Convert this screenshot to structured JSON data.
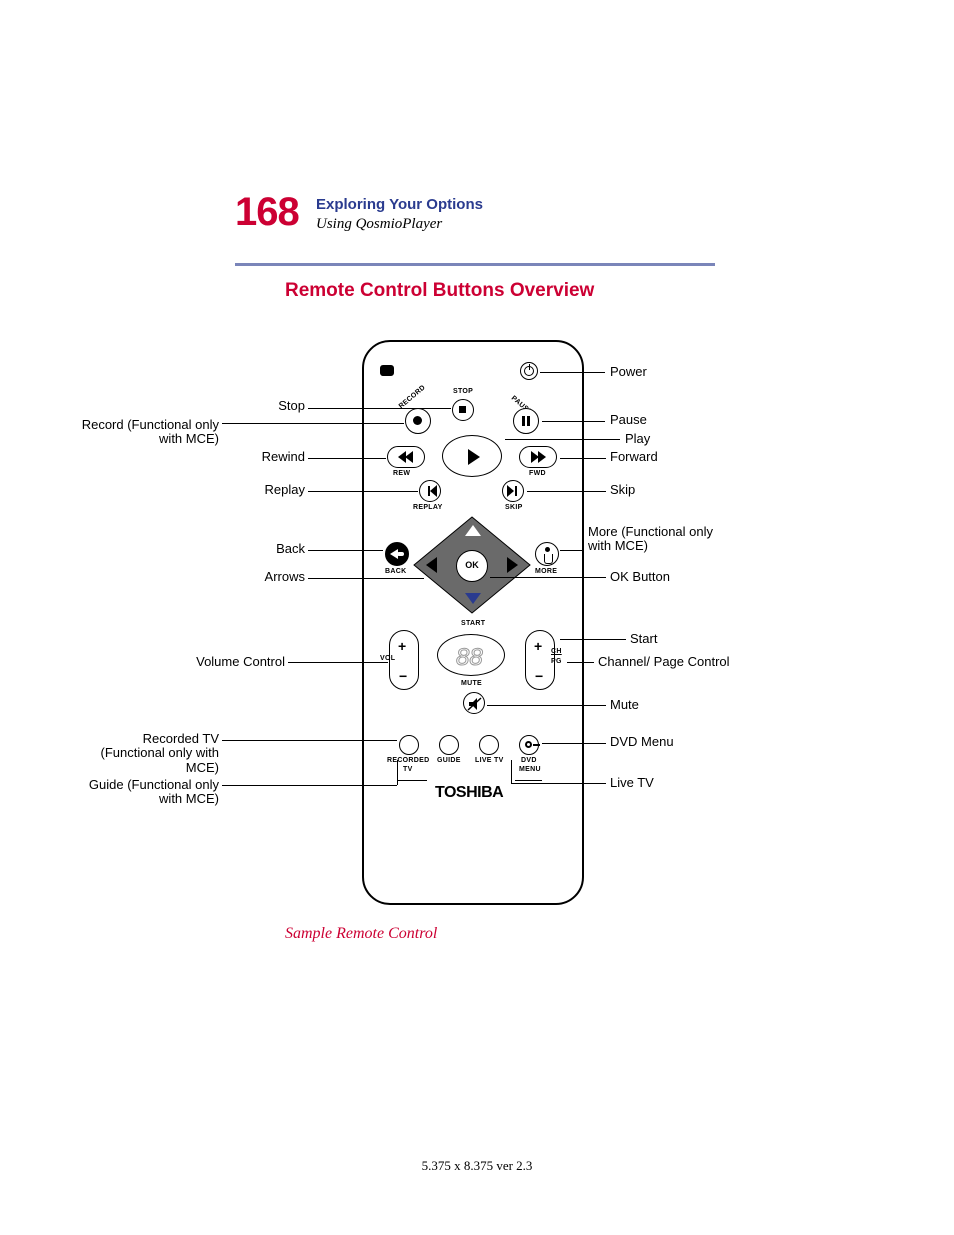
{
  "header": {
    "page_number": "168",
    "chapter": "Exploring Your Options",
    "section": "Using QosmioPlayer"
  },
  "subheading": "Remote Control Buttons Overview",
  "remote": {
    "brand": "TOSHIBA",
    "labels": {
      "left": {
        "stop": "Stop",
        "record": "Record (Functional only with MCE)",
        "rewind": "Rewind",
        "replay": "Replay",
        "back": "Back",
        "arrows": "Arrows",
        "volume": "Volume Control",
        "recorded_tv": "Recorded TV (Functional only with MCE)",
        "guide": "Guide (Functional only with MCE)"
      },
      "right": {
        "power": "Power",
        "pause": "Pause",
        "play": "Play",
        "forward": "Forward",
        "skip": "Skip",
        "more": "More (Functional only with MCE)",
        "ok": "OK Button",
        "start": "Start",
        "channel": "Channel/ Page Control",
        "mute": "Mute",
        "dvd_menu": "DVD Menu",
        "live_tv": "Live TV"
      }
    },
    "btn_text": {
      "stop": "STOP",
      "record": "RECORD",
      "pause": "PAUSE",
      "rew": "REW",
      "fwd": "FWD",
      "replay": "REPLAY",
      "skip": "SKIP",
      "back": "BACK",
      "more": "MORE",
      "ok": "OK",
      "start": "START",
      "vol": "VOL",
      "ch": "CH",
      "pg": "PG",
      "mute": "MUTE",
      "recorded_tv_line1": "RECORDED",
      "recorded_tv_line2": "TV",
      "guide": "GUIDE",
      "live_tv": "LIVE TV",
      "dvd_line1": "DVD",
      "dvd_line2": "MENU"
    }
  },
  "caption": "Sample Remote Control",
  "footer": "5.375 x 8.375 ver 2.3"
}
